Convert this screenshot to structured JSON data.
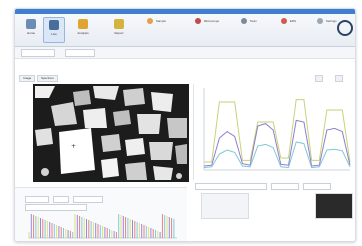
{
  "ribbon": {
    "buttons": [
      {
        "label": "Home",
        "icon": "home-icon"
      },
      {
        "label": "Live",
        "icon": "camera-icon"
      },
      {
        "label": "Analysis",
        "icon": "folder-icon"
      },
      {
        "label": "Report",
        "icon": "document-icon"
      }
    ],
    "groups": [
      {
        "label": "Sample"
      },
      {
        "label": "Microscope"
      },
      {
        "label": "Scan"
      },
      {
        "label": "EDS"
      },
      {
        "label": "Settings"
      }
    ]
  },
  "strip": {
    "left_select": "",
    "right_select": ""
  },
  "tabs": [
    {
      "label": "Image"
    },
    {
      "label": "Spectrum"
    }
  ],
  "chart_data": {
    "type": "line",
    "title": "",
    "xlabel": "",
    "ylabel": "",
    "series": [
      {
        "color": "#c7d27a",
        "values": [
          10,
          10,
          85,
          85,
          85,
          12,
          12,
          60,
          60,
          60,
          15,
          15,
          88,
          88,
          12,
          12,
          75,
          75,
          75,
          10
        ]
      },
      {
        "color": "#8f7bd1",
        "values": [
          5,
          6,
          40,
          48,
          42,
          8,
          6,
          55,
          58,
          50,
          7,
          6,
          62,
          60,
          5,
          6,
          50,
          52,
          48,
          6
        ]
      },
      {
        "color": "#7fc7d7",
        "values": [
          3,
          4,
          20,
          25,
          22,
          5,
          4,
          30,
          32,
          28,
          4,
          3,
          35,
          33,
          3,
          4,
          25,
          26,
          24,
          4
        ]
      }
    ]
  },
  "bottom_chart": {
    "series": [
      {
        "color": "#d9e27a"
      },
      {
        "color": "#9a86da"
      },
      {
        "color": "#ec7d86"
      },
      {
        "color": "#84c9d8"
      }
    ]
  },
  "colors": {
    "accent": "#3f7fd1",
    "panel_bg": "#ffffff",
    "micrograph_bg": "#1c1c1c"
  }
}
